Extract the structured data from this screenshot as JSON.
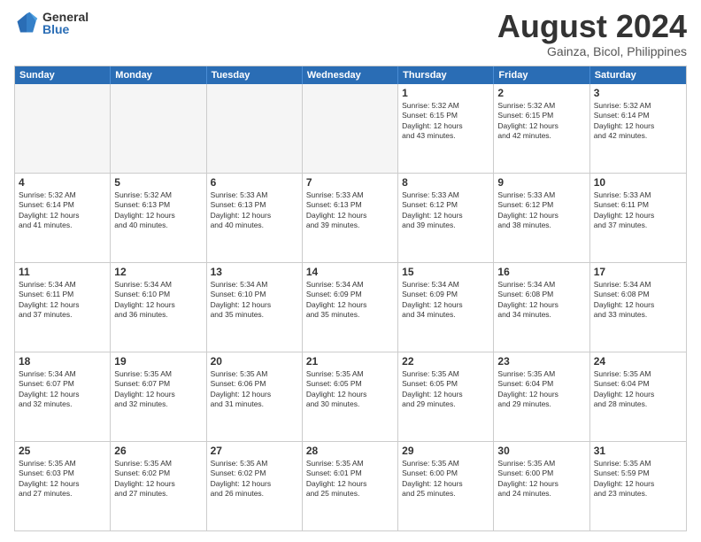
{
  "logo": {
    "general": "General",
    "blue": "Blue"
  },
  "title": "August 2024",
  "subtitle": "Gainza, Bicol, Philippines",
  "header_days": [
    "Sunday",
    "Monday",
    "Tuesday",
    "Wednesday",
    "Thursday",
    "Friday",
    "Saturday"
  ],
  "weeks": [
    [
      {
        "day": "",
        "empty": true,
        "text": ""
      },
      {
        "day": "",
        "empty": true,
        "text": ""
      },
      {
        "day": "",
        "empty": true,
        "text": ""
      },
      {
        "day": "",
        "empty": true,
        "text": ""
      },
      {
        "day": "1",
        "empty": false,
        "text": "Sunrise: 5:32 AM\nSunset: 6:15 PM\nDaylight: 12 hours\nand 43 minutes."
      },
      {
        "day": "2",
        "empty": false,
        "text": "Sunrise: 5:32 AM\nSunset: 6:15 PM\nDaylight: 12 hours\nand 42 minutes."
      },
      {
        "day": "3",
        "empty": false,
        "text": "Sunrise: 5:32 AM\nSunset: 6:14 PM\nDaylight: 12 hours\nand 42 minutes."
      }
    ],
    [
      {
        "day": "4",
        "empty": false,
        "text": "Sunrise: 5:32 AM\nSunset: 6:14 PM\nDaylight: 12 hours\nand 41 minutes."
      },
      {
        "day": "5",
        "empty": false,
        "text": "Sunrise: 5:32 AM\nSunset: 6:13 PM\nDaylight: 12 hours\nand 40 minutes."
      },
      {
        "day": "6",
        "empty": false,
        "text": "Sunrise: 5:33 AM\nSunset: 6:13 PM\nDaylight: 12 hours\nand 40 minutes."
      },
      {
        "day": "7",
        "empty": false,
        "text": "Sunrise: 5:33 AM\nSunset: 6:13 PM\nDaylight: 12 hours\nand 39 minutes."
      },
      {
        "day": "8",
        "empty": false,
        "text": "Sunrise: 5:33 AM\nSunset: 6:12 PM\nDaylight: 12 hours\nand 39 minutes."
      },
      {
        "day": "9",
        "empty": false,
        "text": "Sunrise: 5:33 AM\nSunset: 6:12 PM\nDaylight: 12 hours\nand 38 minutes."
      },
      {
        "day": "10",
        "empty": false,
        "text": "Sunrise: 5:33 AM\nSunset: 6:11 PM\nDaylight: 12 hours\nand 37 minutes."
      }
    ],
    [
      {
        "day": "11",
        "empty": false,
        "text": "Sunrise: 5:34 AM\nSunset: 6:11 PM\nDaylight: 12 hours\nand 37 minutes."
      },
      {
        "day": "12",
        "empty": false,
        "text": "Sunrise: 5:34 AM\nSunset: 6:10 PM\nDaylight: 12 hours\nand 36 minutes."
      },
      {
        "day": "13",
        "empty": false,
        "text": "Sunrise: 5:34 AM\nSunset: 6:10 PM\nDaylight: 12 hours\nand 35 minutes."
      },
      {
        "day": "14",
        "empty": false,
        "text": "Sunrise: 5:34 AM\nSunset: 6:09 PM\nDaylight: 12 hours\nand 35 minutes."
      },
      {
        "day": "15",
        "empty": false,
        "text": "Sunrise: 5:34 AM\nSunset: 6:09 PM\nDaylight: 12 hours\nand 34 minutes."
      },
      {
        "day": "16",
        "empty": false,
        "text": "Sunrise: 5:34 AM\nSunset: 6:08 PM\nDaylight: 12 hours\nand 34 minutes."
      },
      {
        "day": "17",
        "empty": false,
        "text": "Sunrise: 5:34 AM\nSunset: 6:08 PM\nDaylight: 12 hours\nand 33 minutes."
      }
    ],
    [
      {
        "day": "18",
        "empty": false,
        "text": "Sunrise: 5:34 AM\nSunset: 6:07 PM\nDaylight: 12 hours\nand 32 minutes."
      },
      {
        "day": "19",
        "empty": false,
        "text": "Sunrise: 5:35 AM\nSunset: 6:07 PM\nDaylight: 12 hours\nand 32 minutes."
      },
      {
        "day": "20",
        "empty": false,
        "text": "Sunrise: 5:35 AM\nSunset: 6:06 PM\nDaylight: 12 hours\nand 31 minutes."
      },
      {
        "day": "21",
        "empty": false,
        "text": "Sunrise: 5:35 AM\nSunset: 6:05 PM\nDaylight: 12 hours\nand 30 minutes."
      },
      {
        "day": "22",
        "empty": false,
        "text": "Sunrise: 5:35 AM\nSunset: 6:05 PM\nDaylight: 12 hours\nand 29 minutes."
      },
      {
        "day": "23",
        "empty": false,
        "text": "Sunrise: 5:35 AM\nSunset: 6:04 PM\nDaylight: 12 hours\nand 29 minutes."
      },
      {
        "day": "24",
        "empty": false,
        "text": "Sunrise: 5:35 AM\nSunset: 6:04 PM\nDaylight: 12 hours\nand 28 minutes."
      }
    ],
    [
      {
        "day": "25",
        "empty": false,
        "text": "Sunrise: 5:35 AM\nSunset: 6:03 PM\nDaylight: 12 hours\nand 27 minutes."
      },
      {
        "day": "26",
        "empty": false,
        "text": "Sunrise: 5:35 AM\nSunset: 6:02 PM\nDaylight: 12 hours\nand 27 minutes."
      },
      {
        "day": "27",
        "empty": false,
        "text": "Sunrise: 5:35 AM\nSunset: 6:02 PM\nDaylight: 12 hours\nand 26 minutes."
      },
      {
        "day": "28",
        "empty": false,
        "text": "Sunrise: 5:35 AM\nSunset: 6:01 PM\nDaylight: 12 hours\nand 25 minutes."
      },
      {
        "day": "29",
        "empty": false,
        "text": "Sunrise: 5:35 AM\nSunset: 6:00 PM\nDaylight: 12 hours\nand 25 minutes."
      },
      {
        "day": "30",
        "empty": false,
        "text": "Sunrise: 5:35 AM\nSunset: 6:00 PM\nDaylight: 12 hours\nand 24 minutes."
      },
      {
        "day": "31",
        "empty": false,
        "text": "Sunrise: 5:35 AM\nSunset: 5:59 PM\nDaylight: 12 hours\nand 23 minutes."
      }
    ]
  ]
}
